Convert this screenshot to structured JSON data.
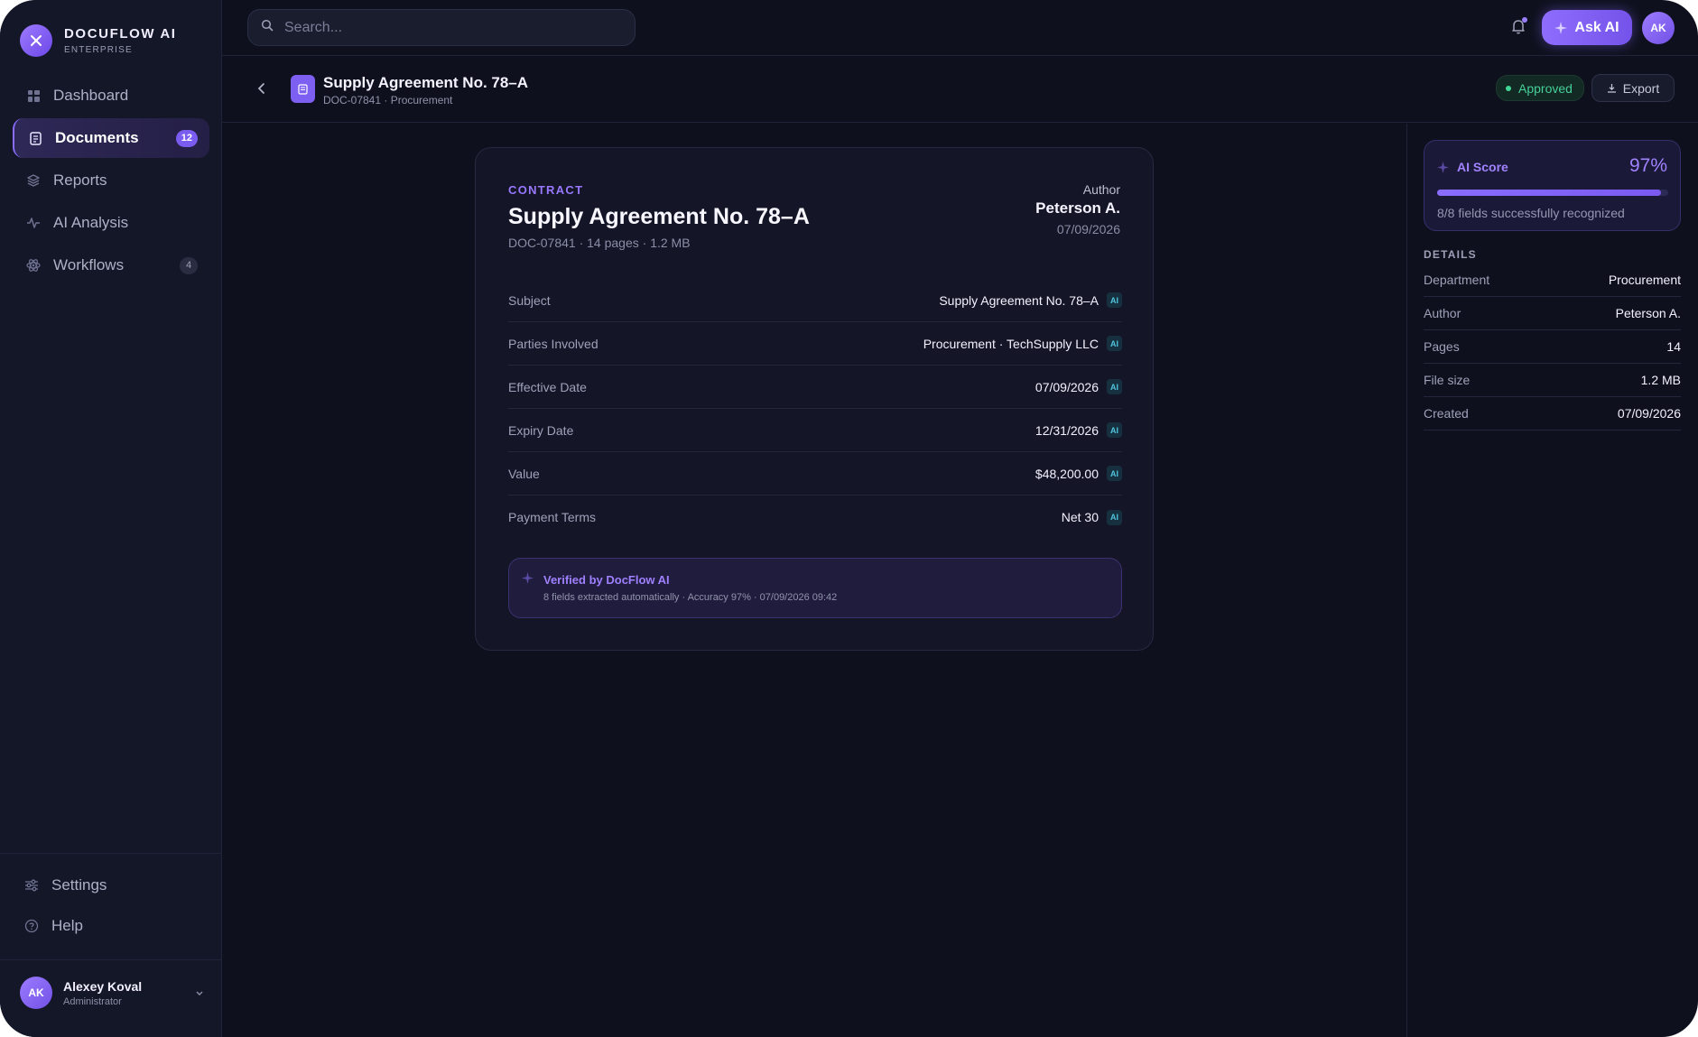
{
  "brand": {
    "name": "DOCUFLOW AI",
    "tier": "ENTERPRISE",
    "logo_icon": "close-x-icon"
  },
  "sidebar": {
    "items": [
      {
        "label": "Dashboard",
        "icon": "dashboard-grid-icon",
        "active": false,
        "badge": ""
      },
      {
        "label": "Documents",
        "icon": "document-icon",
        "active": true,
        "badge": "12"
      },
      {
        "label": "Reports",
        "icon": "layers-icon",
        "active": false,
        "badge": ""
      },
      {
        "label": "AI Analysis",
        "icon": "activity-icon",
        "active": false,
        "badge": ""
      },
      {
        "label": "Workflows",
        "icon": "atom-icon",
        "active": false,
        "badge": "4"
      }
    ],
    "bottom_items": [
      {
        "label": "Settings",
        "icon": "sliders-icon"
      },
      {
        "label": "Help",
        "icon": "help-circle-icon"
      }
    ]
  },
  "user": {
    "initials": "AK",
    "name": "Alexey Koval",
    "role": "Administrator"
  },
  "topbar": {
    "search_placeholder": "Search...",
    "ask_ai_label": "Ask AI",
    "avatar_initials": "AK"
  },
  "doc_header": {
    "title": "Supply Agreement No. 78–A",
    "subtitle": "DOC-07841 · Procurement",
    "status": "Approved",
    "export_label": "Export"
  },
  "card": {
    "type": "CONTRACT",
    "title": "Supply Agreement No. 78–A",
    "meta": "DOC-07841 · 14 pages · 1.2 MB",
    "author_label": "Author",
    "author_name": "Peterson A.",
    "author_date": "07/09/2026",
    "fields": [
      {
        "label": "Subject",
        "value": "Supply Agreement No. 78–A",
        "tag": "AI"
      },
      {
        "label": "Parties Involved",
        "value": "Procurement · TechSupply LLC",
        "tag": "AI"
      },
      {
        "label": "Effective Date",
        "value": "07/09/2026",
        "tag": "AI"
      },
      {
        "label": "Expiry Date",
        "value": "12/31/2026",
        "tag": "AI"
      },
      {
        "label": "Value",
        "value": "$48,200.00",
        "tag": "AI"
      },
      {
        "label": "Payment Terms",
        "value": "Net 30",
        "tag": "AI"
      }
    ],
    "verified_title": "Verified by DocFlow AI",
    "verified_sub": "8 fields extracted automatically · Accuracy 97% · 07/09/2026 09:42"
  },
  "ai_score": {
    "label": "AI Score",
    "value_text": "97%",
    "fraction": 0.97,
    "note": "8/8 fields successfully recognized"
  },
  "details": {
    "heading": "DETAILS",
    "rows": [
      {
        "label": "Department",
        "value": "Procurement"
      },
      {
        "label": "Author",
        "value": "Peterson A."
      },
      {
        "label": "Pages",
        "value": "14"
      },
      {
        "label": "File size",
        "value": "1.2 MB"
      },
      {
        "label": "Created",
        "value": "07/09/2026"
      }
    ]
  },
  "colors": {
    "accent": "#7b5cf0",
    "background": "#0e111d",
    "approved": "#45d19a",
    "ai_tag": "#4fc3dc"
  }
}
